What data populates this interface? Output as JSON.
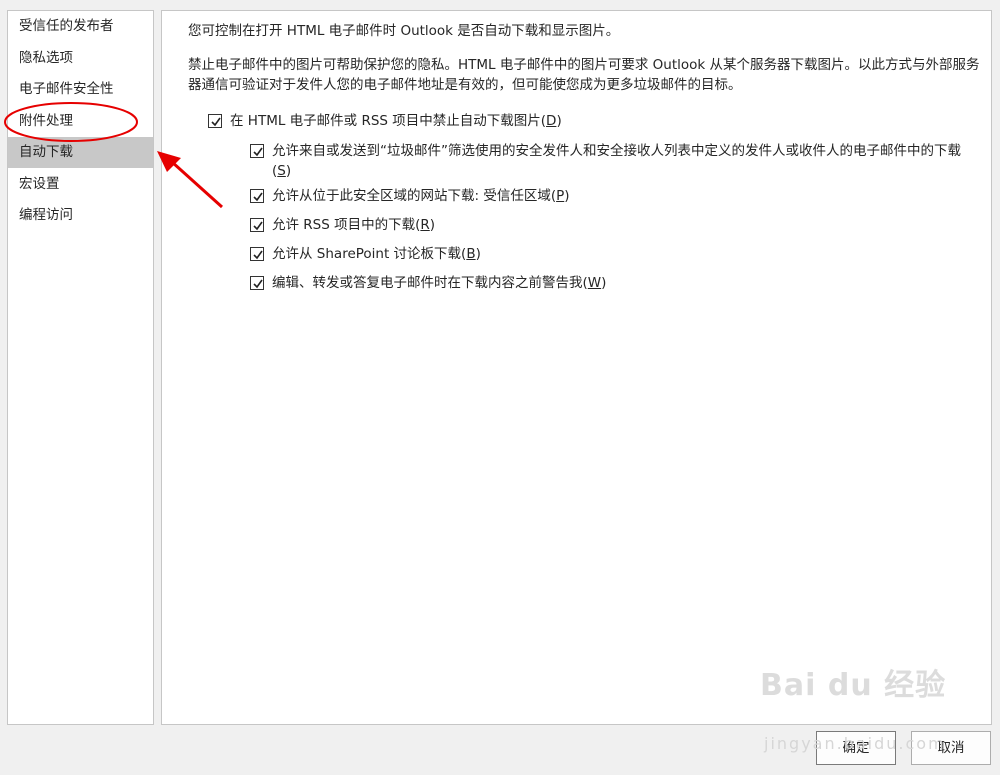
{
  "sidebar": {
    "items": [
      {
        "label": "受信任的发布者"
      },
      {
        "label": "隐私选项"
      },
      {
        "label": "电子邮件安全性"
      },
      {
        "label": "附件处理"
      },
      {
        "label": "自动下载",
        "selected": true
      },
      {
        "label": "宏设置"
      },
      {
        "label": "编程访问"
      }
    ]
  },
  "main": {
    "intro": "您可控制在打开 HTML 电子邮件时 Outlook 是否自动下载和显示图片。",
    "description": "禁止电子邮件中的图片可帮助保护您的隐私。HTML 电子邮件中的图片可要求 Outlook 从某个服务器下载图片。以此方式与外部服务器通信可验证对于发件人您的电子邮件地址是有效的，但可能使您成为更多垃圾邮件的目标。",
    "block_download": {
      "text": "在 HTML 电子邮件或 RSS 项目中禁止自动下载图片(",
      "key": "D",
      "end": ")",
      "checked": true
    },
    "options": [
      {
        "text": "允许来自或发送到“垃圾邮件”筛选使用的安全发件人和安全接收人列表中定义的发件人或收件人的电子邮件中的下载(",
        "key": "S",
        "end": ")",
        "checked": true
      },
      {
        "text": "允许从位于此安全区域的网站下载: 受信任区域(",
        "key": "P",
        "end": ")",
        "checked": true
      },
      {
        "text": "允许 RSS 项目中的下载(",
        "key": "R",
        "end": ")",
        "checked": true
      },
      {
        "text": "允许从 SharePoint 讨论板下载(",
        "key": "B",
        "end": ")",
        "checked": true
      },
      {
        "text": "编辑、转发或答复电子邮件时在下载内容之前警告我(",
        "key": "W",
        "end": ")",
        "checked": true
      }
    ]
  },
  "footer": {
    "ok_label": "确定",
    "cancel_label": "取消"
  },
  "watermark": {
    "brand": "Bai du 经验",
    "url": "jingyan.baidu.com"
  },
  "colors": {
    "annotation": "#e60000",
    "selected_bg": "#c8c8c8"
  }
}
